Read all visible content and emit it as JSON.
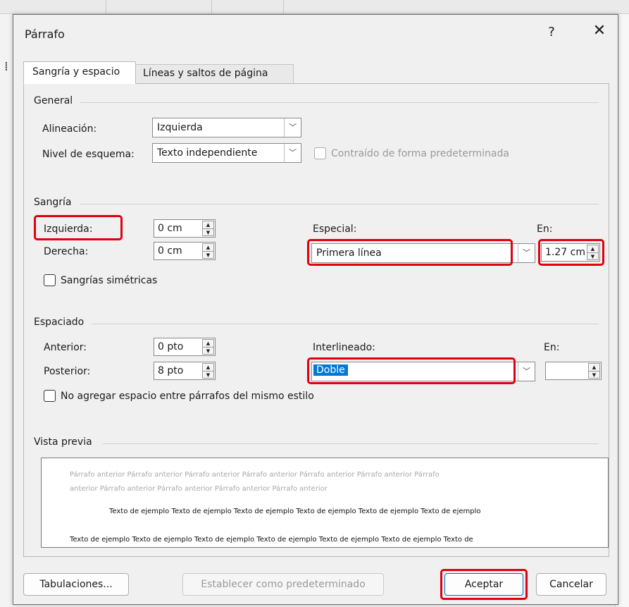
{
  "dialog": {
    "title": "Párrafo",
    "help": "?",
    "close": "✕"
  },
  "tabs": {
    "indent_spacing": "Sangría y espacio",
    "lines_breaks": "Líneas y saltos de página"
  },
  "general": {
    "heading": "General",
    "alignment_label": "Alineación:",
    "alignment_value": "Izquierda",
    "outline_label": "Nivel de esquema:",
    "outline_value": "Texto independiente",
    "collapsed_label": "Contraído de forma predeterminada"
  },
  "indent": {
    "heading": "Sangría",
    "left_label": "Izquierda:",
    "left_value": "0 cm",
    "right_label": "Derecha:",
    "right_value": "0 cm",
    "special_label": "Especial:",
    "special_value": "Primera línea",
    "by_label": "En:",
    "by_value": "1.27 cm",
    "mirror_label": "Sangrías simétricas"
  },
  "spacing": {
    "heading": "Espaciado",
    "before_label": "Anterior:",
    "before_value": "0 pto",
    "after_label": "Posterior:",
    "after_value": "8 pto",
    "line_label": "Interlineado:",
    "line_value": "Doble",
    "at_label": "En:",
    "at_value": "",
    "no_space_label": "No agregar espacio entre párrafos del mismo estilo"
  },
  "preview": {
    "heading": "Vista previa",
    "previous_line1": "Párrafo anterior Párrafo anterior Párrafo anterior Párrafo anterior Párrafo anterior Párrafo anterior Párrafo",
    "previous_line2": "anterior Párrafo anterior Párrafo anterior Párrafo anterior Párrafo anterior",
    "sample_line1": "Texto de ejemplo Texto de ejemplo Texto de ejemplo Texto de ejemplo Texto de ejemplo Texto de ejemplo",
    "sample_line2": "Texto de ejemplo Texto de ejemplo Texto de ejemplo Texto de ejemplo Texto de ejemplo Texto de ejemplo Texto de"
  },
  "buttons": {
    "tabs": "Tabulaciones...",
    "set_default": "Establecer como predeterminado",
    "ok": "Aceptar",
    "cancel": "Cancelar"
  },
  "colors": {
    "highlight_red": "#e00010",
    "selection_blue": "#0078d7"
  }
}
